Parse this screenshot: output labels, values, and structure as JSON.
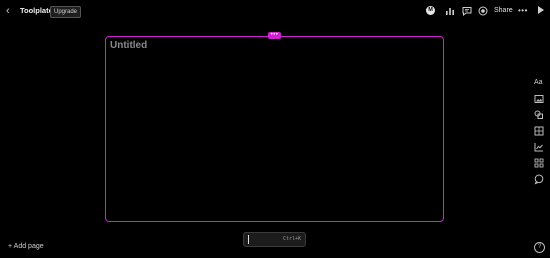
{
  "header": {
    "back_icon": "chevron-left-icon",
    "title": "Toolplate",
    "upgrade_label": "Upgrade",
    "avatar_initials": "M",
    "share_label": "Share",
    "more_label": "•••",
    "icons": [
      "chart-icon",
      "comment-icon",
      "record-icon",
      "play-icon"
    ]
  },
  "canvas": {
    "frame_title": "Untitled",
    "handle_label": "•••",
    "accent_color": "#d020d0"
  },
  "right_rail": {
    "text_tool_label": "Aa",
    "icons": [
      "text-icon",
      "image-icon",
      "shapes-icon",
      "table-icon",
      "chart-icon",
      "widgets-icon",
      "comments-icon"
    ]
  },
  "command_bar": {
    "shortcut_hint": "Ctrl+K"
  },
  "footer": {
    "add_page_label": "+ Add page",
    "help_label": "?"
  }
}
